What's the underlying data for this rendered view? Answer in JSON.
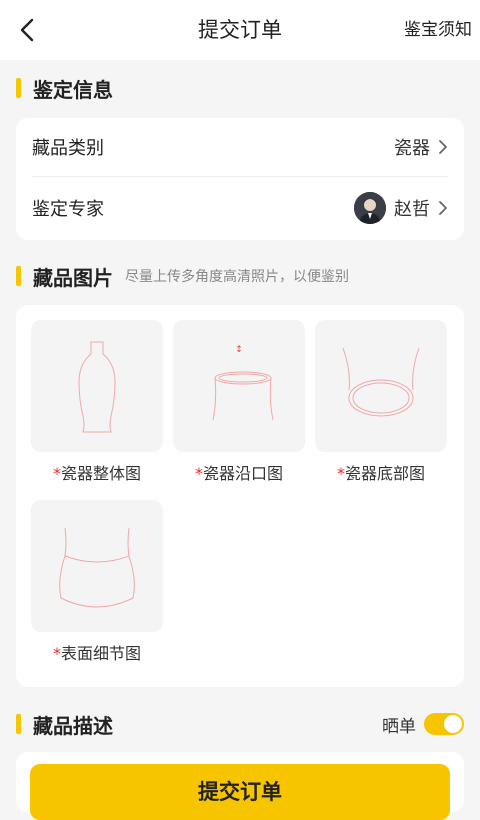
{
  "header": {
    "title": "提交订单",
    "right_link": "鉴宝须知"
  },
  "appraisal_info": {
    "section_title": "鉴定信息",
    "category_label": "藏品类别",
    "category_value": "瓷器",
    "expert_label": "鉴定专家",
    "expert_name": "赵哲"
  },
  "photos": {
    "section_title": "藏品图片",
    "section_hint": "尽量上传多角度高清照片，以便鉴别",
    "required_mark": "*",
    "slots": [
      {
        "label": "瓷器整体图",
        "icon": "vase-outline-icon"
      },
      {
        "label": "瓷器沿口图",
        "icon": "vase-rim-icon"
      },
      {
        "label": "瓷器底部图",
        "icon": "vase-bottom-icon"
      },
      {
        "label": "表面细节图",
        "icon": "vase-surface-icon"
      }
    ]
  },
  "description": {
    "section_title": "藏品描述",
    "share_label": "晒单",
    "share_enabled": true
  },
  "footer": {
    "submit_label": "提交订单"
  },
  "colors": {
    "accent": "#f7c400",
    "required": "#e0312a",
    "background": "#f5f5f5"
  }
}
